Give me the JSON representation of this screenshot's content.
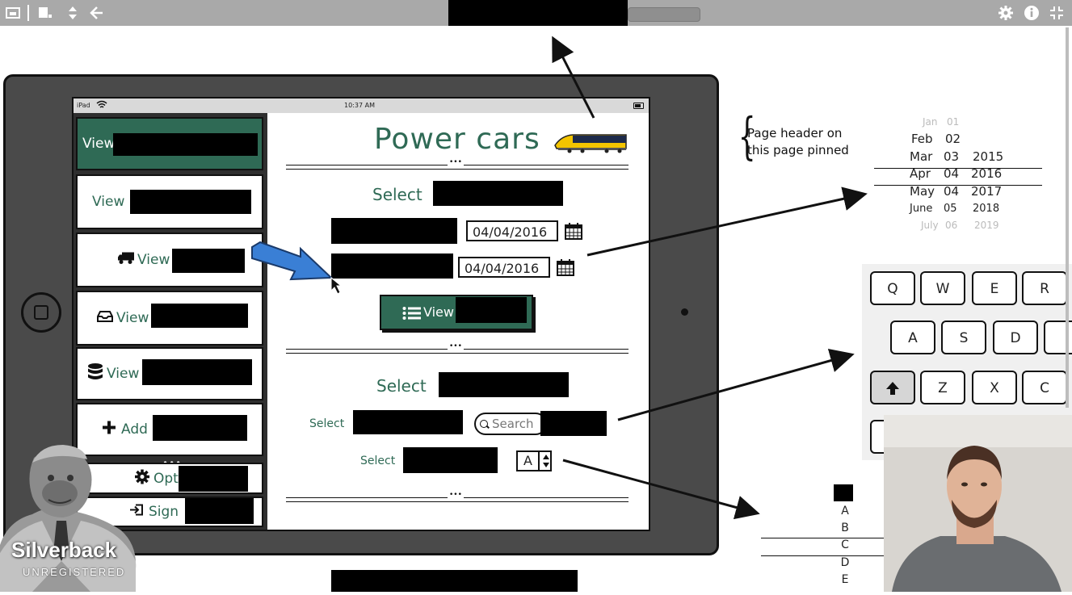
{
  "toolbar": {
    "icons": [
      "screen-record-icon",
      "window-icon",
      "sort-icon",
      "back-arrow-icon",
      "gear-icon",
      "info-icon",
      "collapse-icon"
    ]
  },
  "device": {
    "status": {
      "carrier": "iPad",
      "time": "10:37 AM"
    }
  },
  "sidebar": {
    "items": [
      {
        "label": "View",
        "icon": "",
        "active": true
      },
      {
        "label": "View",
        "icon": ""
      },
      {
        "label": "View",
        "icon": "truck-icon"
      },
      {
        "label": "View",
        "icon": "inbox-icon"
      },
      {
        "label": "View",
        "icon": "database-icon"
      },
      {
        "label": "Add",
        "icon": "plus-icon"
      },
      {
        "label": "Opt",
        "icon": "gear-icon"
      },
      {
        "label": "Sign",
        "icon": "sign-out-icon"
      }
    ],
    "dots": "•••"
  },
  "main": {
    "title": "Power cars",
    "section1": {
      "heading": "Select",
      "date_from": "04/04/2016",
      "date_to": "04/04/2016",
      "view_button_label": "View"
    },
    "section2": {
      "heading": "Select",
      "select_label_1": "Select",
      "search_placeholder": "Search",
      "select_label_2": "Select",
      "stepper_value": "A"
    },
    "divider_dots": "•••"
  },
  "annotations": {
    "header_note_line1": "Page header on",
    "header_note_line2": "this page pinned",
    "date_picker": [
      {
        "month": "Jan",
        "day": "01",
        "year": ""
      },
      {
        "month": "Feb",
        "day": "02",
        "year": ""
      },
      {
        "month": "Mar",
        "day": "03",
        "year": "2015"
      },
      {
        "month": "Apr",
        "day": "04",
        "year": "2016"
      },
      {
        "month": "May",
        "day": "04",
        "year": "2017"
      },
      {
        "month": "June",
        "day": "05",
        "year": "2018"
      },
      {
        "month": "July",
        "day": "06",
        "year": "2019"
      }
    ],
    "keyboard_rows": [
      [
        "Q",
        "W",
        "E",
        "R"
      ],
      [
        "A",
        "S",
        "D",
        ""
      ],
      [
        "",
        "Z",
        "X",
        "C"
      ]
    ],
    "letter_list": [
      "A",
      "B",
      "C",
      "D",
      "E"
    ]
  },
  "watermark": {
    "brand": "Silverback",
    "status": "UNREGISTERED"
  },
  "colors": {
    "accent": "#2f6a55",
    "toolbar": "#a9a9a9",
    "frame": "#4a4a4a",
    "pointer_arrow": "#3a7fd5"
  }
}
